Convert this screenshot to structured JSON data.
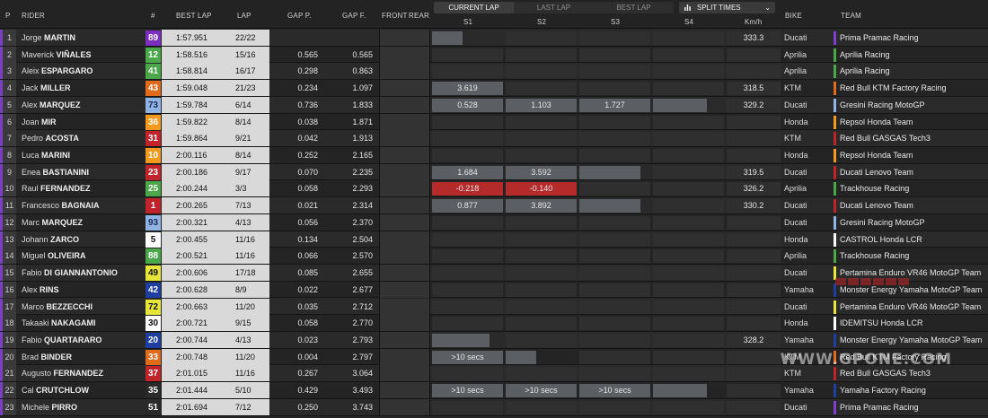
{
  "header": {
    "p": "P",
    "rider": "RIDER",
    "num": "#",
    "best_lap": "BEST LAP",
    "lap": "LAP",
    "gap_p": "GAP P.",
    "gap_f": "GAP F.",
    "front": "FRONT",
    "rear": "REAR",
    "s1": "S1",
    "s2": "S2",
    "s3": "S3",
    "s4": "S4",
    "kmh": "Km/h",
    "bike": "BIKE",
    "team": "TEAM"
  },
  "lap_mode": {
    "options": [
      "CURRENT LAP",
      "LAST LAP",
      "BEST LAP"
    ],
    "selected": "CURRENT LAP"
  },
  "view_select": {
    "label": "SPLIT TIMES",
    "icon": "bar-chart-icon"
  },
  "rows": [
    {
      "p": "1",
      "first": "Jorge",
      "last": "MARTIN",
      "num": "89",
      "num_bg": "#7b2fc0",
      "num_fg": "#ffffff",
      "best": "1:57.951",
      "lap": "22/22",
      "gp": "",
      "gf": "",
      "s1": "",
      "s1c": "fill-short",
      "s2": "",
      "s2c": "",
      "s3": "",
      "s3c": "",
      "s4": "",
      "s4c": "",
      "kmh": "333.3",
      "bike": "Ducati",
      "team": "Prima Pramac Racing",
      "team_color": "#7c3fd0"
    },
    {
      "p": "2",
      "first": "Maverick",
      "last": "VIÑALES",
      "num": "12",
      "num_bg": "#4aa84a",
      "num_fg": "#ffffff",
      "best": "1:58.516",
      "lap": "15/16",
      "gp": "0.565",
      "gf": "0.565",
      "s1": "",
      "s1c": "",
      "s2": "",
      "s2c": "",
      "s3": "",
      "s3c": "",
      "s4": "",
      "s4c": "",
      "kmh": "",
      "bike": "Aprilia",
      "team": "Aprilia Racing",
      "team_color": "#4aa84a"
    },
    {
      "p": "3",
      "first": "Aleix",
      "last": "ESPARGARO",
      "num": "41",
      "num_bg": "#4aa84a",
      "num_fg": "#ffffff",
      "best": "1:58.814",
      "lap": "16/17",
      "gp": "0.298",
      "gf": "0.863",
      "s1": "",
      "s1c": "",
      "s2": "",
      "s2c": "",
      "s3": "",
      "s3c": "",
      "s4": "",
      "s4c": "",
      "kmh": "",
      "bike": "Aprilia",
      "team": "Aprilia Racing",
      "team_color": "#4aa84a"
    },
    {
      "p": "4",
      "first": "Jack",
      "last": "MILLER",
      "num": "43",
      "num_bg": "#e26b1b",
      "num_fg": "#ffffff",
      "best": "1:59.048",
      "lap": "21/23",
      "gp": "0.234",
      "gf": "1.097",
      "s1": "3.619",
      "s1c": "fill",
      "s2": "",
      "s2c": "",
      "s3": "",
      "s3c": "",
      "s4": "",
      "s4c": "",
      "kmh": "318.5",
      "bike": "KTM",
      "team": "Red Bull KTM Factory Racing",
      "team_color": "#e26b1b"
    },
    {
      "p": "5",
      "first": "Alex",
      "last": "MARQUEZ",
      "num": "73",
      "num_bg": "#8fb4e3",
      "num_fg": "#1a2a5a",
      "best": "1:59.784",
      "lap": "6/14",
      "gp": "0.736",
      "gf": "1.833",
      "s1": "0.528",
      "s1c": "fill",
      "s2": "1.103",
      "s2c": "fill",
      "s3": "1.727",
      "s3c": "fill",
      "s4": "",
      "s4c": "fill-short",
      "kmh": "329.2",
      "bike": "Ducati",
      "team": "Gresini Racing MotoGP",
      "team_color": "#8fb4e3"
    },
    {
      "p": "6",
      "first": "Joan",
      "last": "MIR",
      "num": "36",
      "num_bg": "#f39a1e",
      "num_fg": "#ffffff",
      "best": "1:59.822",
      "lap": "8/14",
      "gp": "0.038",
      "gf": "1.871",
      "s1": "",
      "s1c": "",
      "s2": "",
      "s2c": "",
      "s3": "",
      "s3c": "",
      "s4": "",
      "s4c": "",
      "kmh": "",
      "bike": "Honda",
      "team": "Repsol Honda Team",
      "team_color": "#f39a1e"
    },
    {
      "p": "7",
      "first": "Pedro",
      "last": "ACOSTA",
      "num": "31",
      "num_bg": "#c0242a",
      "num_fg": "#ffffff",
      "best": "1:59.864",
      "lap": "9/21",
      "gp": "0.042",
      "gf": "1.913",
      "s1": "",
      "s1c": "",
      "s2": "",
      "s2c": "",
      "s3": "",
      "s3c": "",
      "s4": "",
      "s4c": "",
      "kmh": "",
      "bike": "KTM",
      "team": "Red Bull GASGAS Tech3",
      "team_color": "#c0242a"
    },
    {
      "p": "8",
      "first": "Luca",
      "last": "MARINI",
      "num": "10",
      "num_bg": "#f39a1e",
      "num_fg": "#ffffff",
      "best": "2:00.116",
      "lap": "8/14",
      "gp": "0.252",
      "gf": "2.165",
      "s1": "",
      "s1c": "",
      "s2": "",
      "s2c": "",
      "s3": "",
      "s3c": "",
      "s4": "",
      "s4c": "",
      "kmh": "",
      "bike": "Honda",
      "team": "Repsol Honda Team",
      "team_color": "#f39a1e"
    },
    {
      "p": "9",
      "first": "Enea",
      "last": "BASTIANINI",
      "num": "23",
      "num_bg": "#c0242a",
      "num_fg": "#ffffff",
      "best": "2:00.186",
      "lap": "9/17",
      "gp": "0.070",
      "gf": "2.235",
      "s1": "1.684",
      "s1c": "fill",
      "s2": "3.592",
      "s2c": "fill",
      "s3": "",
      "s3c": "fill-short",
      "s4": "",
      "s4c": "",
      "kmh": "319.5",
      "bike": "Ducati",
      "team": "Ducati Lenovo Team",
      "team_color": "#c0242a"
    },
    {
      "p": "10",
      "first": "Raul",
      "last": "FERNANDEZ",
      "num": "25",
      "num_bg": "#4aa84a",
      "num_fg": "#ffffff",
      "best": "2:00.244",
      "lap": "3/3",
      "gp": "0.058",
      "gf": "2.293",
      "s1": "-0.218",
      "s1c": "red",
      "s2": "-0.140",
      "s2c": "red",
      "s3": "",
      "s3c": "",
      "s4": "",
      "s4c": "",
      "kmh": "326.2",
      "bike": "Aprilia",
      "team": "Trackhouse Racing",
      "team_color": "#4aa84a"
    },
    {
      "p": "11",
      "first": "Francesco",
      "last": "BAGNAIA",
      "num": "1",
      "num_bg": "#c0242a",
      "num_fg": "#ffffff",
      "best": "2:00.265",
      "lap": "7/13",
      "gp": "0.021",
      "gf": "2.314",
      "s1": "0.877",
      "s1c": "fill",
      "s2": "3.892",
      "s2c": "fill",
      "s3": "",
      "s3c": "fill-short",
      "s4": "",
      "s4c": "",
      "kmh": "330.2",
      "bike": "Ducati",
      "team": "Ducati Lenovo Team",
      "team_color": "#c0242a"
    },
    {
      "p": "12",
      "first": "Marc",
      "last": "MARQUEZ",
      "num": "93",
      "num_bg": "#8fb4e3",
      "num_fg": "#1a2a5a",
      "best": "2:00.321",
      "lap": "4/13",
      "gp": "0.056",
      "gf": "2.370",
      "s1": "",
      "s1c": "",
      "s2": "",
      "s2c": "",
      "s3": "",
      "s3c": "",
      "s4": "",
      "s4c": "",
      "kmh": "",
      "bike": "Ducati",
      "team": "Gresini Racing MotoGP",
      "team_color": "#8fb4e3"
    },
    {
      "p": "13",
      "first": "Johann",
      "last": "ZARCO",
      "num": "5",
      "num_bg": "#ffffff",
      "num_fg": "#111111",
      "best": "2:00.455",
      "lap": "11/16",
      "gp": "0.134",
      "gf": "2.504",
      "s1": "",
      "s1c": "",
      "s2": "",
      "s2c": "",
      "s3": "",
      "s3c": "",
      "s4": "",
      "s4c": "",
      "kmh": "",
      "bike": "Honda",
      "team": "CASTROL Honda LCR",
      "team_color": "#ffffff"
    },
    {
      "p": "14",
      "first": "Miguel",
      "last": "OLIVEIRA",
      "num": "88",
      "num_bg": "#4aa84a",
      "num_fg": "#ffffff",
      "best": "2:00.521",
      "lap": "11/16",
      "gp": "0.066",
      "gf": "2.570",
      "s1": "",
      "s1c": "",
      "s2": "",
      "s2c": "",
      "s3": "",
      "s3c": "",
      "s4": "",
      "s4c": "",
      "kmh": "",
      "bike": "Aprilia",
      "team": "Trackhouse Racing",
      "team_color": "#4aa84a"
    },
    {
      "p": "15",
      "first": "Fabio",
      "last": "DI GIANNANTONIO",
      "num": "49",
      "num_bg": "#e6e63a",
      "num_fg": "#111111",
      "best": "2:00.606",
      "lap": "17/18",
      "gp": "0.085",
      "gf": "2.655",
      "s1": "",
      "s1c": "",
      "s2": "",
      "s2c": "",
      "s3": "",
      "s3c": "",
      "s4": "",
      "s4c": "",
      "kmh": "",
      "bike": "Ducati",
      "team": "Pertamina Enduro VR46 MotoGP Team",
      "team_color": "#e6e63a"
    },
    {
      "p": "16",
      "first": "Alex",
      "last": "RINS",
      "num": "42",
      "num_bg": "#1f3fa0",
      "num_fg": "#ffffff",
      "best": "2:00.628",
      "lap": "8/9",
      "gp": "0.022",
      "gf": "2.677",
      "s1": "",
      "s1c": "",
      "s2": "",
      "s2c": "",
      "s3": "",
      "s3c": "",
      "s4": "",
      "s4c": "",
      "kmh": "",
      "bike": "Yamaha",
      "team": "Monster Energy Yamaha MotoGP Team",
      "team_color": "#1f3fa0"
    },
    {
      "p": "17",
      "first": "Marco",
      "last": "BEZZECCHI",
      "num": "72",
      "num_bg": "#e6e63a",
      "num_fg": "#111111",
      "best": "2:00.663",
      "lap": "11/20",
      "gp": "0.035",
      "gf": "2.712",
      "s1": "",
      "s1c": "",
      "s2": "",
      "s2c": "",
      "s3": "",
      "s3c": "",
      "s4": "",
      "s4c": "",
      "kmh": "",
      "bike": "Ducati",
      "team": "Pertamina Enduro VR46 MotoGP Team",
      "team_color": "#e6e63a"
    },
    {
      "p": "18",
      "first": "Takaaki",
      "last": "NAKAGAMI",
      "num": "30",
      "num_bg": "#ffffff",
      "num_fg": "#111111",
      "best": "2:00.721",
      "lap": "9/15",
      "gp": "0.058",
      "gf": "2.770",
      "s1": "",
      "s1c": "",
      "s2": "",
      "s2c": "",
      "s3": "",
      "s3c": "",
      "s4": "",
      "s4c": "",
      "kmh": "",
      "bike": "Honda",
      "team": "IDEMITSU Honda LCR",
      "team_color": "#ffffff"
    },
    {
      "p": "19",
      "first": "Fabio",
      "last": "QUARTARARO",
      "num": "20",
      "num_bg": "#1f3fa0",
      "num_fg": "#ffffff",
      "best": "2:00.744",
      "lap": "4/13",
      "gp": "0.023",
      "gf": "2.793",
      "s1": "",
      "s1c": "fill-mid",
      "s2": "",
      "s2c": "",
      "s3": "",
      "s3c": "",
      "s4": "",
      "s4c": "",
      "kmh": "328.2",
      "bike": "Yamaha",
      "team": "Monster Energy Yamaha MotoGP Team",
      "team_color": "#1f3fa0"
    },
    {
      "p": "20",
      "first": "Brad",
      "last": "BINDER",
      "num": "33",
      "num_bg": "#e26b1b",
      "num_fg": "#ffffff",
      "best": "2:00.748",
      "lap": "11/20",
      "gp": "0.004",
      "gf": "2.797",
      "s1": ">10 secs",
      "s1c": "fill",
      "s2": "",
      "s2c": "fill-short",
      "s3": "",
      "s3c": "",
      "s4": "",
      "s4c": "",
      "kmh": "",
      "bike": "KTM",
      "team": "Red Bull KTM Factory Racing",
      "team_color": "#e26b1b"
    },
    {
      "p": "21",
      "first": "Augusto",
      "last": "FERNANDEZ",
      "num": "37",
      "num_bg": "#c0242a",
      "num_fg": "#ffffff",
      "best": "2:01.015",
      "lap": "11/16",
      "gp": "0.267",
      "gf": "3.064",
      "s1": "",
      "s1c": "",
      "s2": "",
      "s2c": "",
      "s3": "",
      "s3c": "",
      "s4": "",
      "s4c": "",
      "kmh": "",
      "bike": "KTM",
      "team": "Red Bull GASGAS Tech3",
      "team_color": "#c0242a"
    },
    {
      "p": "22",
      "first": "Cal",
      "last": "CRUTCHLOW",
      "num": "35",
      "num_bg": "#2a2a2a",
      "num_fg": "#ffffff",
      "best": "2:01.444",
      "lap": "5/10",
      "gp": "0.429",
      "gf": "3.493",
      "s1": ">10 secs",
      "s1c": "fill",
      "s2": ">10 secs",
      "s2c": "fill",
      "s3": ">10 secs",
      "s3c": "fill",
      "s4": "",
      "s4c": "fill-short",
      "kmh": "",
      "bike": "Yamaha",
      "team": "Yamaha Factory Racing",
      "team_color": "#1f3fa0"
    },
    {
      "p": "23",
      "first": "Michele",
      "last": "PIRRO",
      "num": "51",
      "num_bg": "#2a2a2a",
      "num_fg": "#ffffff",
      "best": "2:01.694",
      "lap": "7/12",
      "gp": "0.250",
      "gf": "3.743",
      "s1": "",
      "s1c": "",
      "s2": "",
      "s2c": "",
      "s3": "",
      "s3c": "",
      "s4": "",
      "s4c": "",
      "kmh": "",
      "bike": "Ducati",
      "team": "Prima Pramac Racing",
      "team_color": "#7c3fd0"
    }
  ],
  "watermark": "WWW.GPONE.COM"
}
